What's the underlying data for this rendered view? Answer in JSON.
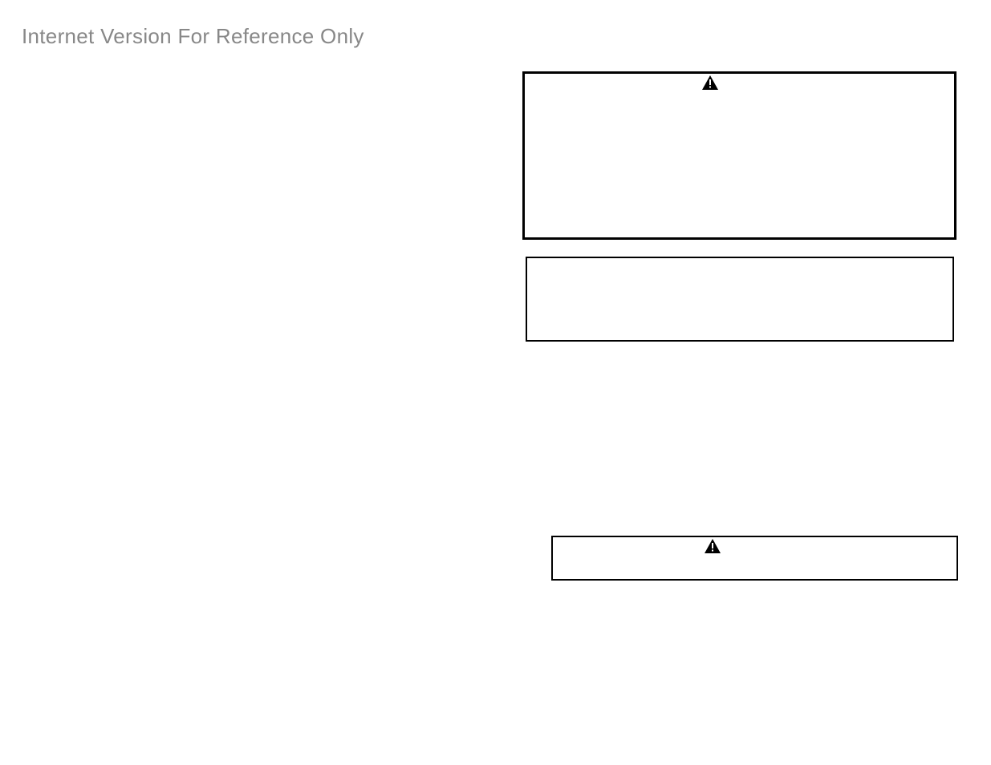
{
  "watermark": "Internet Version For Reference Only",
  "boxes": {
    "box1": {
      "label": ""
    },
    "box2": {
      "label": ""
    },
    "box3": {
      "label": ""
    }
  },
  "icons": {
    "warning1": "warning-icon",
    "warning2": "warning-icon"
  }
}
